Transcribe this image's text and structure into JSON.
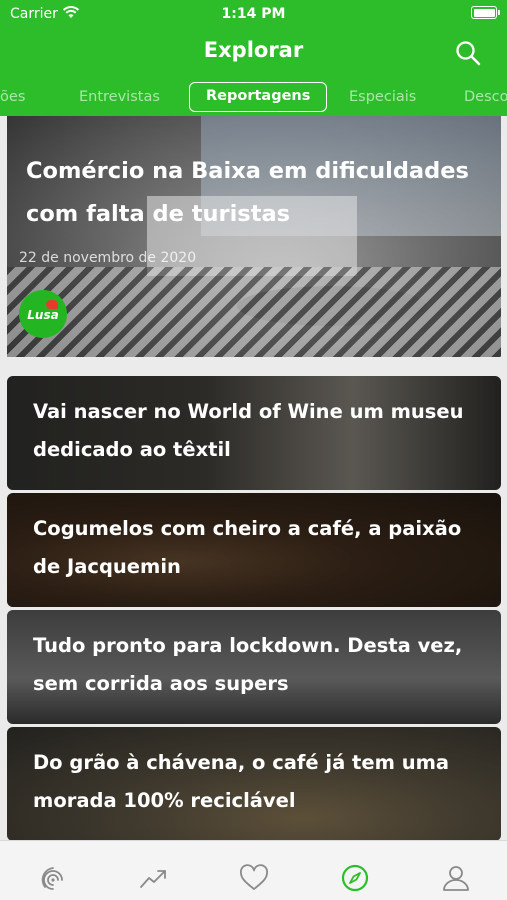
{
  "status_bar": {
    "carrier": "Carrier",
    "time": "1:14 PM"
  },
  "header": {
    "title": "Explorar"
  },
  "tabs": [
    {
      "label": "iões"
    },
    {
      "label": "Entrevistas"
    },
    {
      "label": "Reportagens",
      "active": true
    },
    {
      "label": "Especiais"
    },
    {
      "label": "Desco"
    }
  ],
  "hero": {
    "title": "Comércio na Baixa em dificuldades com falta de turistas",
    "date": "22 de novembro de 2020",
    "source": "Lusa"
  },
  "articles": [
    {
      "title": "Vai nascer no World of Wine um museu dedicado ao têxtil"
    },
    {
      "title": "Cogumelos com cheiro a café, a paixão de Jacquemin"
    },
    {
      "title": "Tudo pronto para lockdown. Desta vez, sem corrida aos supers"
    },
    {
      "title": "Do grão à chávena, o café já tem uma morada 100% reciclável"
    }
  ],
  "bottom_nav": [
    {
      "icon": "feed-icon",
      "active": false
    },
    {
      "icon": "trending-icon",
      "active": false
    },
    {
      "icon": "heart-icon",
      "active": false
    },
    {
      "icon": "compass-icon",
      "active": true
    },
    {
      "icon": "user-icon",
      "active": false
    }
  ],
  "colors": {
    "brand_green": "#2dbd2a",
    "inactive_icon": "#8a8a8a"
  }
}
